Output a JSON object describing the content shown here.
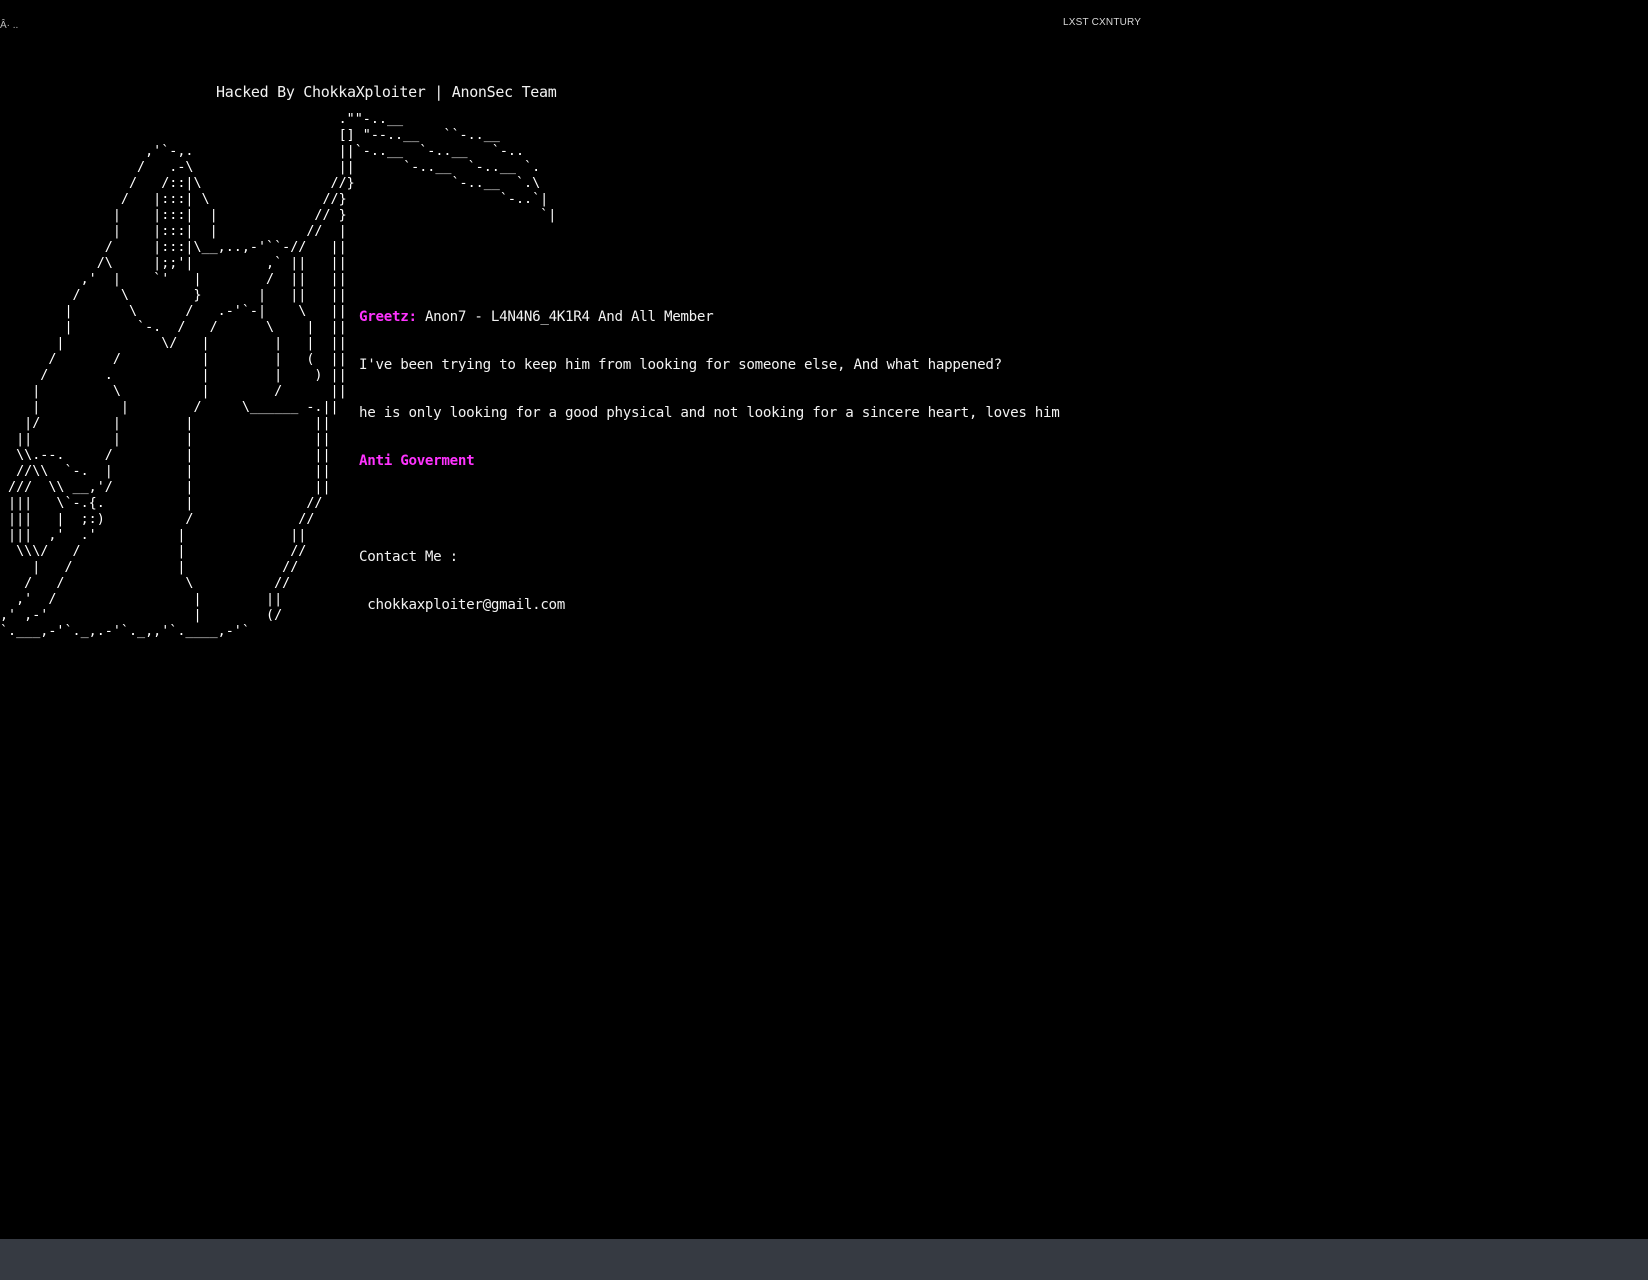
{
  "corner_glyph": "Â· ..",
  "corner_label": "LXST CXNTURY",
  "headline": "Hacked By ChokkaXploiter | AnonSec Team",
  "ascii_art": "                                          .\"\"-..__\n                                          [] \"--..__   ``-..__\n                  ,'`-,.                  ||`-..__  `-..__   `-..\n                 /   .-\\                  ||      `-..__  `-..__ `.\n                /   /::|\\                //}            `-..__  `.\\\n               /   |:::| \\              //}                   `-..`|\n              |    |:::|  |            // }                        `|\n              |    |:::|  |           //  |\n             /     |:::|\\__,..,-'``-//   ||\n            /\\     |;;'|         ,` ||   ||\n          ,'  |    `'   |        /  ||   ||\n         /     \\        }       |   ||   ||\n        |       \\      /   .-'`-|    \\   ||\n        |        `-.  /   /      \\    |  ||\n       |            \\/   |        |   |  ||\n      /       /          |        |   (  ||\n     /       .           |        |    ) ||\n    |         \\          |        /      ||\n    |          |        /     \\______ -.||\n   |/         |        |               ||\n  ||          |        |               ||\n  \\\\.--.     /         |               ||\n  //\\\\  `-.  |         |               ||\n ///  \\\\ __,'/         |               ||\n |||   \\`-.{.          |              //\n |||   |  ;:)          /             //\n |||  ,'  .'          |             ||\n  \\\\\\/   /            |             //\n    |   /             |            //\n   /   /               \\          //\n  ,'  /                 |        ||\n,' ,-'                  |        (/\n`.___,-'`._,.-'`._,,'`.____,-'`",
  "message": {
    "greetz_label": "Greetz:",
    "greetz_text": " Anon7 - L4N4N6_4K1R4 And All Member",
    "line2": "I've been trying to keep him from looking for someone else, And what happened?",
    "line3": "he is only looking for a good physical and not looking for a sincere heart, loves him",
    "slogan": "Anti Goverment",
    "contact_label": "Contact Me :",
    "contact_email": " chokkaxploiter@gmail.com"
  },
  "colors": {
    "background": "#000000",
    "text": "#f2f2f2",
    "accent": "#ff33ff",
    "bottom_bar": "#363a42"
  }
}
